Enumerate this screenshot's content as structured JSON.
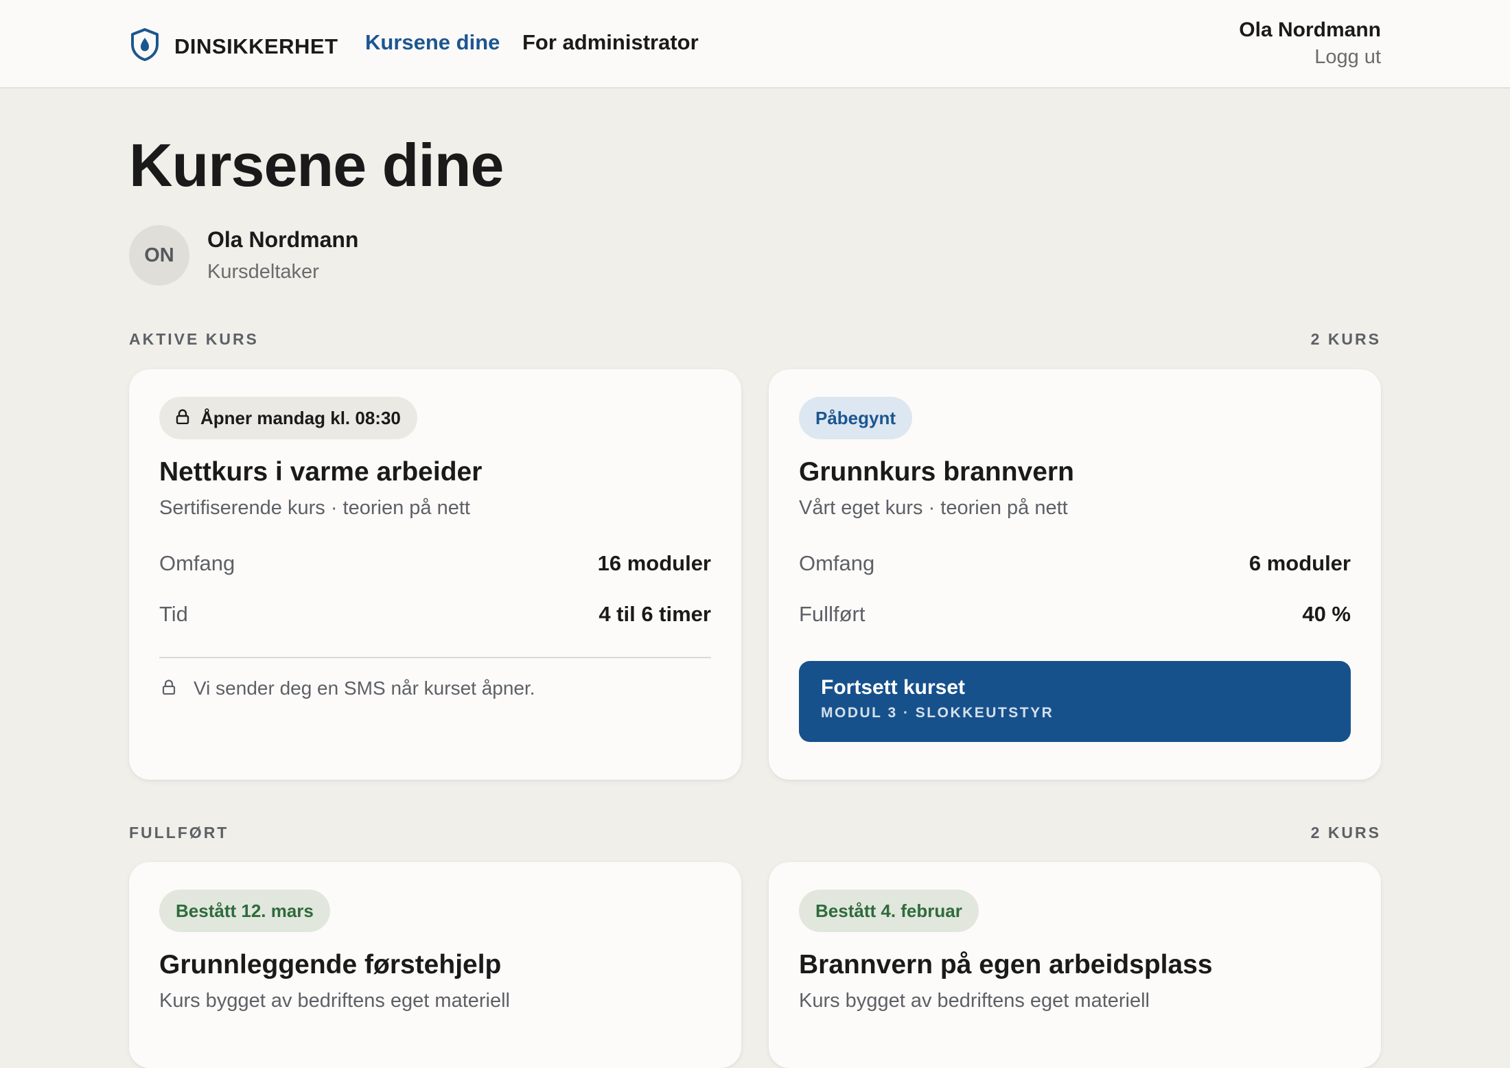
{
  "header": {
    "brand": "DINSIKKERHET",
    "nav": [
      {
        "label": "Kursene dine",
        "active": true
      },
      {
        "label": "For administrator",
        "active": false
      }
    ],
    "user_name": "Ola Nordmann",
    "logout": "Logg ut"
  },
  "page": {
    "title": "Kursene dine",
    "profile": {
      "initials": "ON",
      "name": "Ola Nordmann",
      "role": "Kursdeltaker"
    }
  },
  "sections": {
    "active": {
      "heading": "AKTIVE KURS",
      "count": "2 KURS",
      "cards": [
        {
          "status": "Åpner mandag kl. 08:30",
          "status_icon": "lock-icon",
          "title": "Nettkurs i varme arbeider",
          "subtitle": "Sertifiserende kurs · teorien på nett",
          "rows": [
            {
              "label": "Omfang",
              "value": "16 moduler"
            },
            {
              "label": "Tid",
              "value": "4 til 6 timer"
            }
          ],
          "notice": "Vi sender deg en SMS når kurset åpner."
        },
        {
          "status": "Påbegynt",
          "title": "Grunnkurs brannvern",
          "subtitle": "Vårt eget kurs · teorien på nett",
          "rows": [
            {
              "label": "Omfang",
              "value": "6 moduler"
            },
            {
              "label": "Fullført",
              "value": "40 %"
            }
          ],
          "progress_fraction": 0.4,
          "cta": {
            "label": "Fortsett kurset",
            "sub": "MODUL 3 · SLOKKEUTSTYR"
          }
        }
      ]
    },
    "completed": {
      "heading": "FULLFØRT",
      "count": "2 KURS",
      "cards": [
        {
          "status": "Bestått 12. mars",
          "title": "Grunnleggende førstehjelp",
          "subtitle": "Kurs bygget av bedriftens eget materiell"
        },
        {
          "status": "Bestått 4. februar",
          "title": "Brannvern på egen arbeidsplass",
          "subtitle": "Kurs bygget av bedriftens eget materiell"
        }
      ]
    }
  },
  "colors": {
    "accent": "#17518c",
    "link_active": "#1c5690",
    "success": "#2f6b3c",
    "background": "#f0efea"
  }
}
